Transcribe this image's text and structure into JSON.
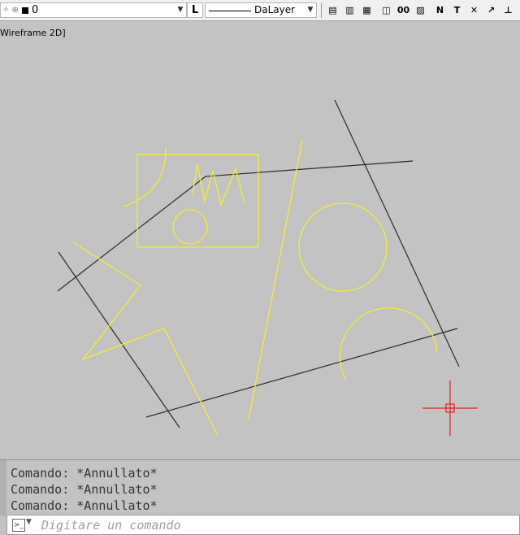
{
  "toolbar": {
    "layer_name": "0",
    "lineweight_icon": "L",
    "linetype_label": "DaLayer",
    "icons": [
      "layer-properties-icon",
      "layer-states-icon",
      "layer-isolate-icon",
      "match-properties-icon",
      "text-style-icon",
      "dimension-style-icon",
      "table-style-icon",
      "multileader-icon",
      "erase-icon",
      "line-icon",
      "perpendicular-icon",
      "extend-icon"
    ],
    "icon_glyphs": [
      "▤",
      "▥",
      "▦",
      "◫",
      "00",
      "▨",
      "N",
      "T",
      "✕",
      "↗",
      "⊥",
      "↘"
    ]
  },
  "viewport": {
    "label": "Wireframe 2D]"
  },
  "drawing": {
    "background": "#c3c3c3",
    "colors": {
      "black": "#2a2a2a",
      "yellow": "#f5ef2a",
      "crosshair": "#e02020"
    }
  },
  "command": {
    "history": [
      "Comando: *Annullato*",
      "Comando: *Annullato*",
      "Comando: *Annullato*"
    ],
    "placeholder": "Digitare un comando"
  }
}
